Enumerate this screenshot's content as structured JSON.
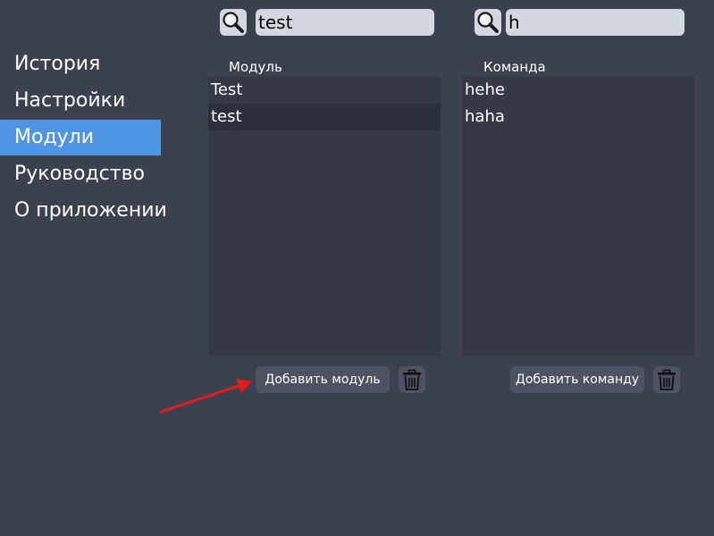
{
  "sidebar": {
    "items": [
      {
        "label": "История"
      },
      {
        "label": "Настройки"
      },
      {
        "label": "Модули"
      },
      {
        "label": "Руководство"
      },
      {
        "label": "О приложении"
      }
    ],
    "active_index": 2
  },
  "modules_panel": {
    "search_value": "test",
    "column_label": "Модуль",
    "items": [
      "Test",
      "test"
    ],
    "selected_index": 1,
    "add_button_label": "Добавить модуль"
  },
  "commands_panel": {
    "search_value": "h",
    "column_label": "Команда",
    "items": [
      "hehe",
      "haha"
    ],
    "add_button_label": "Добавить команду"
  },
  "colors": {
    "background": "#3c4150",
    "accent": "#5095e3",
    "list_background": "#363846",
    "button_background": "#4e5262",
    "annotation_arrow": "#e8191b"
  }
}
